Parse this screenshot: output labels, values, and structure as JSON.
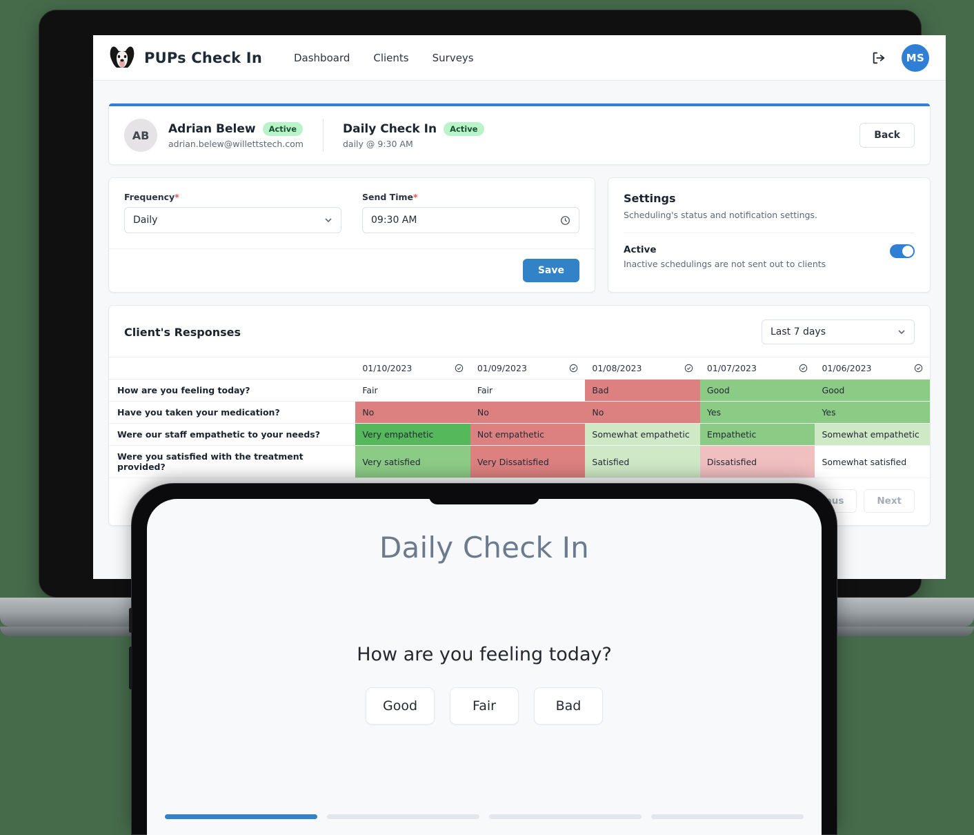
{
  "header": {
    "brand": "PUPs Check In",
    "nav": [
      "Dashboard",
      "Clients",
      "Surveys"
    ],
    "avatar_initials": "MS",
    "logout_icon": "logout-icon",
    "brand_logo_icon": "dog-logo-icon"
  },
  "client": {
    "initials": "AB",
    "name": "Adrian Belew",
    "status": "Active",
    "email": "adrian.belew@willettstech.com",
    "survey_name": "Daily Check In",
    "survey_status": "Active",
    "survey_schedule": "daily @ 9:30 AM",
    "back_label": "Back"
  },
  "form": {
    "frequency_label": "Frequency",
    "frequency_value": "Daily",
    "send_time_label": "Send Time",
    "send_time_value": "09:30 AM",
    "required_mark": "*",
    "save_label": "Save"
  },
  "settings": {
    "title": "Settings",
    "subtitle": "Scheduling's status and notification settings.",
    "active_label": "Active",
    "active_description": "Inactive schedulings are not sent out to clients",
    "toggle_on": true,
    "toggle_color": "#2f7fd4"
  },
  "responses": {
    "title": "Client's Responses",
    "range_value": "Last 7 days",
    "columns": [
      "01/10/2023",
      "01/09/2023",
      "01/08/2023",
      "01/07/2023",
      "01/06/2023"
    ],
    "question_column_header": "",
    "rows": [
      {
        "question": "How are you feeling today?",
        "cells": [
          {
            "value": "Fair",
            "tone": "neutral"
          },
          {
            "value": "Fair",
            "tone": "neutral"
          },
          {
            "value": "Bad",
            "tone": "bad"
          },
          {
            "value": "Good",
            "tone": "good"
          },
          {
            "value": "Good",
            "tone": "good"
          }
        ]
      },
      {
        "question": "Have you taken your medication?",
        "cells": [
          {
            "value": "No",
            "tone": "bad"
          },
          {
            "value": "No",
            "tone": "bad"
          },
          {
            "value": "No",
            "tone": "bad"
          },
          {
            "value": "Yes",
            "tone": "good"
          },
          {
            "value": "Yes",
            "tone": "good"
          }
        ]
      },
      {
        "question": "Were our staff empathetic to your needs?",
        "cells": [
          {
            "value": "Very empathetic",
            "tone": "verygood"
          },
          {
            "value": "Not empathetic",
            "tone": "bad"
          },
          {
            "value": "Somewhat empathetic",
            "tone": "lightgood"
          },
          {
            "value": "Empathetic",
            "tone": "good"
          },
          {
            "value": "Somewhat empathetic",
            "tone": "lightgood"
          }
        ]
      },
      {
        "question": "Were you satisfied with the treatment provided?",
        "cells": [
          {
            "value": "Very satisfied",
            "tone": "good"
          },
          {
            "value": "Very Dissatisfied",
            "tone": "bad"
          },
          {
            "value": "Satisfied",
            "tone": "lightgood"
          },
          {
            "value": "Dissatisfied",
            "tone": "lightbad"
          },
          {
            "value": "Somewhat satisfied",
            "tone": "neutral"
          }
        ]
      }
    ],
    "previous_label": "Previous",
    "next_label": "Next"
  },
  "phone": {
    "title": "Daily Check In",
    "question": "How are you feeling today?",
    "options": [
      "Good",
      "Fair",
      "Bad"
    ],
    "progress_total": 4,
    "progress_active": 1,
    "progress_color": "#3282c8"
  },
  "colors": {
    "background": "#466b4b",
    "accent": "#2f7fd4",
    "verygood": "#55b85a",
    "good": "#8ccb86",
    "lightgood": "#cfe8c6",
    "neutral": "#ffffff",
    "lightbad": "#f0bfc0",
    "bad": "#dd8080"
  }
}
